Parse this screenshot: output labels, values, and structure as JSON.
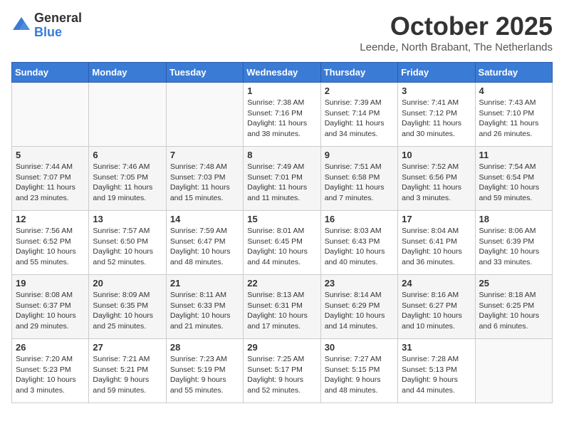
{
  "logo": {
    "general": "General",
    "blue": "Blue"
  },
  "header": {
    "month": "October 2025",
    "location": "Leende, North Brabant, The Netherlands"
  },
  "weekdays": [
    "Sunday",
    "Monday",
    "Tuesday",
    "Wednesday",
    "Thursday",
    "Friday",
    "Saturday"
  ],
  "weeks": [
    [
      {
        "day": "",
        "info": ""
      },
      {
        "day": "",
        "info": ""
      },
      {
        "day": "",
        "info": ""
      },
      {
        "day": "1",
        "info": "Sunrise: 7:38 AM\nSunset: 7:16 PM\nDaylight: 11 hours\nand 38 minutes."
      },
      {
        "day": "2",
        "info": "Sunrise: 7:39 AM\nSunset: 7:14 PM\nDaylight: 11 hours\nand 34 minutes."
      },
      {
        "day": "3",
        "info": "Sunrise: 7:41 AM\nSunset: 7:12 PM\nDaylight: 11 hours\nand 30 minutes."
      },
      {
        "day": "4",
        "info": "Sunrise: 7:43 AM\nSunset: 7:10 PM\nDaylight: 11 hours\nand 26 minutes."
      }
    ],
    [
      {
        "day": "5",
        "info": "Sunrise: 7:44 AM\nSunset: 7:07 PM\nDaylight: 11 hours\nand 23 minutes."
      },
      {
        "day": "6",
        "info": "Sunrise: 7:46 AM\nSunset: 7:05 PM\nDaylight: 11 hours\nand 19 minutes."
      },
      {
        "day": "7",
        "info": "Sunrise: 7:48 AM\nSunset: 7:03 PM\nDaylight: 11 hours\nand 15 minutes."
      },
      {
        "day": "8",
        "info": "Sunrise: 7:49 AM\nSunset: 7:01 PM\nDaylight: 11 hours\nand 11 minutes."
      },
      {
        "day": "9",
        "info": "Sunrise: 7:51 AM\nSunset: 6:58 PM\nDaylight: 11 hours\nand 7 minutes."
      },
      {
        "day": "10",
        "info": "Sunrise: 7:52 AM\nSunset: 6:56 PM\nDaylight: 11 hours\nand 3 minutes."
      },
      {
        "day": "11",
        "info": "Sunrise: 7:54 AM\nSunset: 6:54 PM\nDaylight: 10 hours\nand 59 minutes."
      }
    ],
    [
      {
        "day": "12",
        "info": "Sunrise: 7:56 AM\nSunset: 6:52 PM\nDaylight: 10 hours\nand 55 minutes."
      },
      {
        "day": "13",
        "info": "Sunrise: 7:57 AM\nSunset: 6:50 PM\nDaylight: 10 hours\nand 52 minutes."
      },
      {
        "day": "14",
        "info": "Sunrise: 7:59 AM\nSunset: 6:47 PM\nDaylight: 10 hours\nand 48 minutes."
      },
      {
        "day": "15",
        "info": "Sunrise: 8:01 AM\nSunset: 6:45 PM\nDaylight: 10 hours\nand 44 minutes."
      },
      {
        "day": "16",
        "info": "Sunrise: 8:03 AM\nSunset: 6:43 PM\nDaylight: 10 hours\nand 40 minutes."
      },
      {
        "day": "17",
        "info": "Sunrise: 8:04 AM\nSunset: 6:41 PM\nDaylight: 10 hours\nand 36 minutes."
      },
      {
        "day": "18",
        "info": "Sunrise: 8:06 AM\nSunset: 6:39 PM\nDaylight: 10 hours\nand 33 minutes."
      }
    ],
    [
      {
        "day": "19",
        "info": "Sunrise: 8:08 AM\nSunset: 6:37 PM\nDaylight: 10 hours\nand 29 minutes."
      },
      {
        "day": "20",
        "info": "Sunrise: 8:09 AM\nSunset: 6:35 PM\nDaylight: 10 hours\nand 25 minutes."
      },
      {
        "day": "21",
        "info": "Sunrise: 8:11 AM\nSunset: 6:33 PM\nDaylight: 10 hours\nand 21 minutes."
      },
      {
        "day": "22",
        "info": "Sunrise: 8:13 AM\nSunset: 6:31 PM\nDaylight: 10 hours\nand 17 minutes."
      },
      {
        "day": "23",
        "info": "Sunrise: 8:14 AM\nSunset: 6:29 PM\nDaylight: 10 hours\nand 14 minutes."
      },
      {
        "day": "24",
        "info": "Sunrise: 8:16 AM\nSunset: 6:27 PM\nDaylight: 10 hours\nand 10 minutes."
      },
      {
        "day": "25",
        "info": "Sunrise: 8:18 AM\nSunset: 6:25 PM\nDaylight: 10 hours\nand 6 minutes."
      }
    ],
    [
      {
        "day": "26",
        "info": "Sunrise: 7:20 AM\nSunset: 5:23 PM\nDaylight: 10 hours\nand 3 minutes."
      },
      {
        "day": "27",
        "info": "Sunrise: 7:21 AM\nSunset: 5:21 PM\nDaylight: 9 hours\nand 59 minutes."
      },
      {
        "day": "28",
        "info": "Sunrise: 7:23 AM\nSunset: 5:19 PM\nDaylight: 9 hours\nand 55 minutes."
      },
      {
        "day": "29",
        "info": "Sunrise: 7:25 AM\nSunset: 5:17 PM\nDaylight: 9 hours\nand 52 minutes."
      },
      {
        "day": "30",
        "info": "Sunrise: 7:27 AM\nSunset: 5:15 PM\nDaylight: 9 hours\nand 48 minutes."
      },
      {
        "day": "31",
        "info": "Sunrise: 7:28 AM\nSunset: 5:13 PM\nDaylight: 9 hours\nand 44 minutes."
      },
      {
        "day": "",
        "info": ""
      }
    ]
  ]
}
